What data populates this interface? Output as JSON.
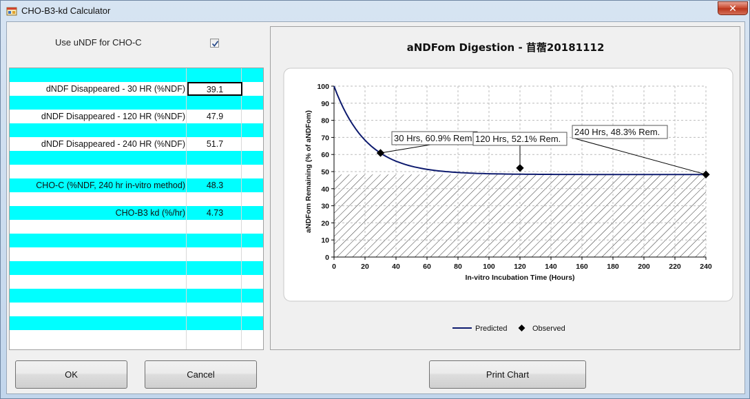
{
  "window": {
    "title": "CHO-B3-kd Calculator",
    "close_glyph": "✕"
  },
  "option": {
    "label": "Use uNDF for CHO-C",
    "checked": true
  },
  "rows": [
    {
      "label": "dNDF Disappeared - 30 HR (%NDF)",
      "value": "39.1",
      "selected": true
    },
    {
      "label": "dNDF Disappeared - 120 HR (%NDF)",
      "value": "47.9"
    },
    {
      "label": "dNDF Disappeared - 240 HR (%NDF)",
      "value": "51.7"
    },
    {
      "label": "CHO-C (%NDF, 240 hr in-vitro method)",
      "value": "48.3"
    },
    {
      "label": "CHO-B3 kd (%/hr)",
      "value": "4.73"
    }
  ],
  "buttons": {
    "ok": "OK",
    "cancel": "Cancel",
    "print": "Print Chart"
  },
  "chart_data": {
    "type": "line",
    "title": "aNDFom Digestion - 苜蓿20181112",
    "xlabel": "In-vitro Incubation Time (Hours)",
    "ylabel": "aNDFom Remaining (% of aNDFom)",
    "xlim": [
      0,
      240
    ],
    "ylim": [
      0,
      100
    ],
    "xticks": [
      0,
      20,
      40,
      60,
      80,
      100,
      120,
      140,
      160,
      180,
      200,
      220,
      240
    ],
    "yticks": [
      0,
      10,
      20,
      30,
      40,
      50,
      60,
      70,
      80,
      90,
      100
    ],
    "grid": true,
    "asymptote": 48.3,
    "kd_percent_per_hr": 4.73,
    "series": [
      {
        "name": "Predicted",
        "kind": "line",
        "color": "#0d1a6e"
      },
      {
        "name": "Observed",
        "kind": "marker",
        "color": "#000000",
        "x": [
          30,
          120,
          240
        ],
        "y": [
          60.9,
          52.1,
          48.3
        ]
      }
    ],
    "annotations": [
      {
        "text": "30 Hrs, 60.9% Rem."
      },
      {
        "text": "120 Hrs, 52.1% Rem."
      },
      {
        "text": "240 Hrs, 48.3% Rem."
      }
    ],
    "legend": {
      "placement": "bottom-center",
      "entries": [
        "Predicted",
        "Observed"
      ]
    }
  }
}
